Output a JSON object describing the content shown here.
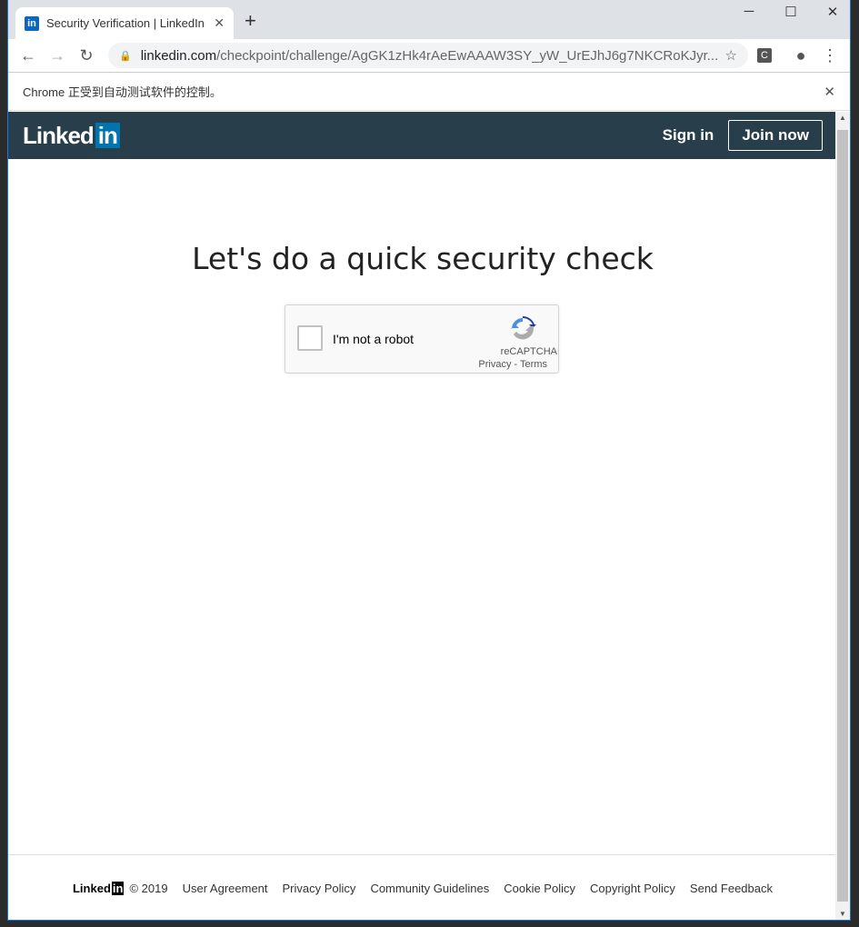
{
  "browser": {
    "tab_title": "Security Verification | LinkedIn",
    "favicon": "in",
    "url_host": "linkedin.com",
    "url_path": "/checkpoint/challenge/AgGK1zHk4rAeEwAAAW3SY_yW_UrEJhJ6g7NKCRoKJyr...",
    "extension_label": "C",
    "infobar_text": "Chrome 正受到自动测试软件的控制。"
  },
  "header": {
    "logo_text": "Linked",
    "logo_in": "in",
    "sign_in": "Sign in",
    "join_now": "Join now"
  },
  "main": {
    "title": "Let's do a quick security check",
    "captcha": {
      "label": "I'm not a robot",
      "brand": "reCAPTCHA",
      "privacy": "Privacy",
      "sep": " - ",
      "terms": "Terms",
      "checked": false
    }
  },
  "footer": {
    "logo_text": "Linked",
    "logo_in": "in",
    "copyright": "© 2019",
    "links": [
      "User Agreement",
      "Privacy Policy",
      "Community Guidelines",
      "Cookie Policy",
      "Copyright Policy",
      "Send Feedback"
    ]
  },
  "colors": {
    "header_bg": "#283e4a",
    "brand_blue": "#0073b1"
  }
}
